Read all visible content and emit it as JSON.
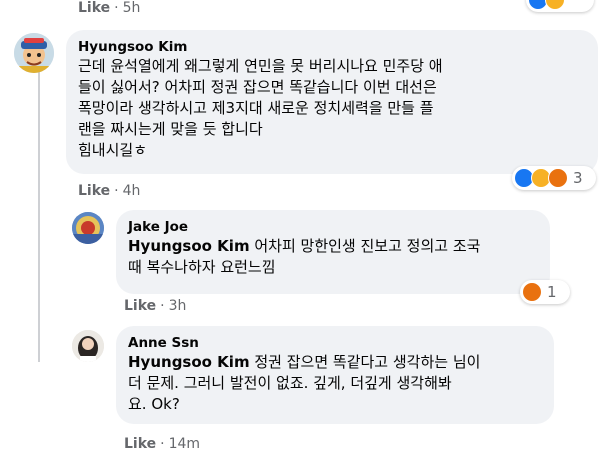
{
  "top": {
    "like_label": "Like",
    "time": "5h"
  },
  "comments": [
    {
      "author": "Hyungsoo Kim",
      "lines": [
        "근데 윤석열에게 왜그렇게 연민을 못 버리시나요 민주당 애",
        "들이 싫어서? 어차피 정권 잡으면 똑같습니다 이번 대선은",
        "폭망이라 생각하시고 제3지대 새로운 정치세력을 만들 플",
        "랜을 짜시는게 맞을 듯 합니다",
        "힘내시길ㅎ"
      ],
      "like_label": "Like",
      "time": "4h",
      "reactions": {
        "icons": [
          "like-reaction",
          "haha-reaction",
          "angry-reaction"
        ],
        "count": "3"
      }
    },
    {
      "author": "Jake Joe",
      "mention": "Hyungsoo Kim",
      "lines": [
        " 어차피 망한인생 진보고 정의고 조국",
        "때 복수나하자 요런느낌"
      ],
      "like_label": "Like",
      "time": "3h",
      "reactions": {
        "icons": [
          "angry-reaction"
        ],
        "count": "1"
      }
    },
    {
      "author": "Anne Ssn",
      "mention": "Hyungsoo Kim",
      "lines": [
        " 정권 잡으면 똑같다고 생각하는 님이",
        "더 문제. 그러니 발전이 없죠. 깊게, 더깊게 생각해봐",
        "요. Ok?"
      ],
      "like_label": "Like",
      "time": "14m"
    }
  ],
  "colors": {
    "bubble": "#f0f2f5",
    "secondary_text": "#65676b",
    "like_blue": "#1877f2",
    "haha_yellow": "#f7b125",
    "angry_orange": "#e9710f"
  }
}
